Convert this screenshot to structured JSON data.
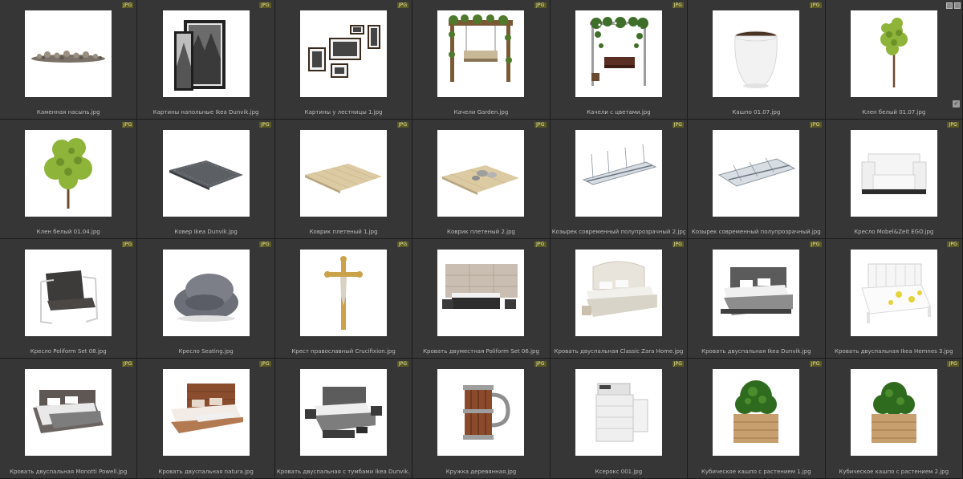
{
  "badge_text": "JPG",
  "items": [
    {
      "label": "Каменная насыпь.jpg",
      "icon": "stone-pile"
    },
    {
      "label": "Картины напольные Ikea Dunvik.jpg",
      "icon": "floor-paintings"
    },
    {
      "label": "Картины у лестницы 1.jpg",
      "icon": "stair-paintings"
    },
    {
      "label": "Качели Garden.jpg",
      "icon": "garden-swing"
    },
    {
      "label": "Качели с цветами.jpg",
      "icon": "flower-swing"
    },
    {
      "label": "Кашпо 01.07.jpg",
      "icon": "white-planter"
    },
    {
      "label": "Клен белый 01.07.jpg",
      "icon": "white-maple-tree"
    },
    {
      "label": "Клен белый 01.04.jpg",
      "icon": "white-maple-tree-2"
    },
    {
      "label": "Ковер Ikea Dunvik.jpg",
      "icon": "grey-rug"
    },
    {
      "label": "Коврик плетеный 1.jpg",
      "icon": "woven-mat"
    },
    {
      "label": "Коврик плетеный 2.jpg",
      "icon": "woven-mat-2"
    },
    {
      "label": "Козырек современный полупрозрачный 2.jpg",
      "icon": "canopy"
    },
    {
      "label": "Козырек современный полупрозрачный.jpg",
      "icon": "canopy-2"
    },
    {
      "label": "Кресло Mobel&Zeit EGO.jpg",
      "icon": "white-armchair"
    },
    {
      "label": "Кресло Poliform Set 08.jpg",
      "icon": "lounge-chair"
    },
    {
      "label": "Кресло Seating.jpg",
      "icon": "bean-bag"
    },
    {
      "label": "Крест православный Crucifixion.jpg",
      "icon": "crucifix"
    },
    {
      "label": "Кровать двуместная Poliform Set 06.jpg",
      "icon": "bed-panel"
    },
    {
      "label": "Кровать двуспальная Classic Zara Home.jpg",
      "icon": "bed-classic"
    },
    {
      "label": "Кровать двуспальная Ikea Dunvik.jpg",
      "icon": "bed-dunvik"
    },
    {
      "label": "Кровать двуспальная Ikea Hemnes 3.jpg",
      "icon": "bed-hemnes"
    },
    {
      "label": "Кровать двуспальная Monotti Powell.jpg",
      "icon": "bed-powell"
    },
    {
      "label": "Кровать двуспальная natura.jpg",
      "icon": "bed-natura"
    },
    {
      "label": "Кровать двуспальная с тумбами Ikea Dunvik.jpg",
      "icon": "bed-nightstands"
    },
    {
      "label": "Кружка деревянная.jpg",
      "icon": "wooden-mug"
    },
    {
      "label": "Ксерокс 001.jpg",
      "icon": "copier"
    },
    {
      "label": "Кубическое кашпо с растением 1.jpg",
      "icon": "cube-planter"
    },
    {
      "label": "Кубическое кашпо с растением 2.jpg",
      "icon": "cube-planter-2"
    }
  ]
}
